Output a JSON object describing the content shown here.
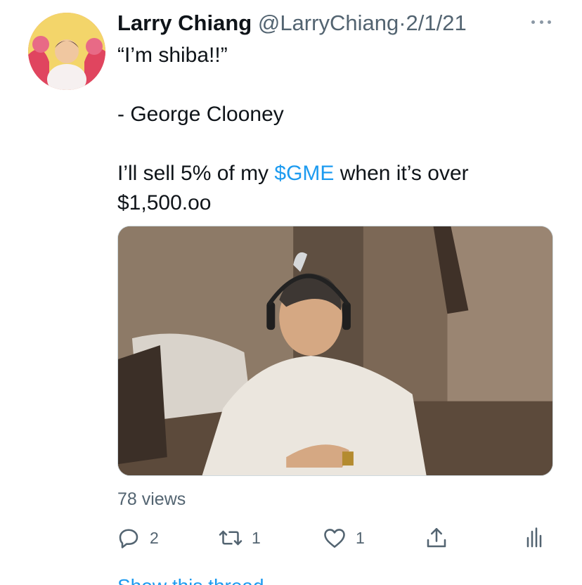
{
  "tweet": {
    "author_name": "Larry Chiang",
    "handle": "@LarryChiang",
    "separator": "·",
    "date": "2/1/21",
    "lines": [
      "“I’m shiba!!”",
      "",
      "- George Clooney",
      "",
      "I’ll sell 5% of my ",
      "$1,500.oo"
    ],
    "cashtag": "$GME",
    "after_cashtag": " when it’s over",
    "views": "78 views"
  },
  "actions": {
    "reply_count": "2",
    "retweet_count": "1",
    "like_count": "1"
  },
  "footer": {
    "show_thread": "Show this thread"
  },
  "icons": {
    "more": "more-dots-icon",
    "reply": "reply-icon",
    "retweet": "retweet-icon",
    "like": "heart-icon",
    "share": "share-icon",
    "analytics": "analytics-icon"
  },
  "colors": {
    "link": "#1d9bf0",
    "secondary_text": "#536471",
    "primary_text": "#0f1419"
  }
}
